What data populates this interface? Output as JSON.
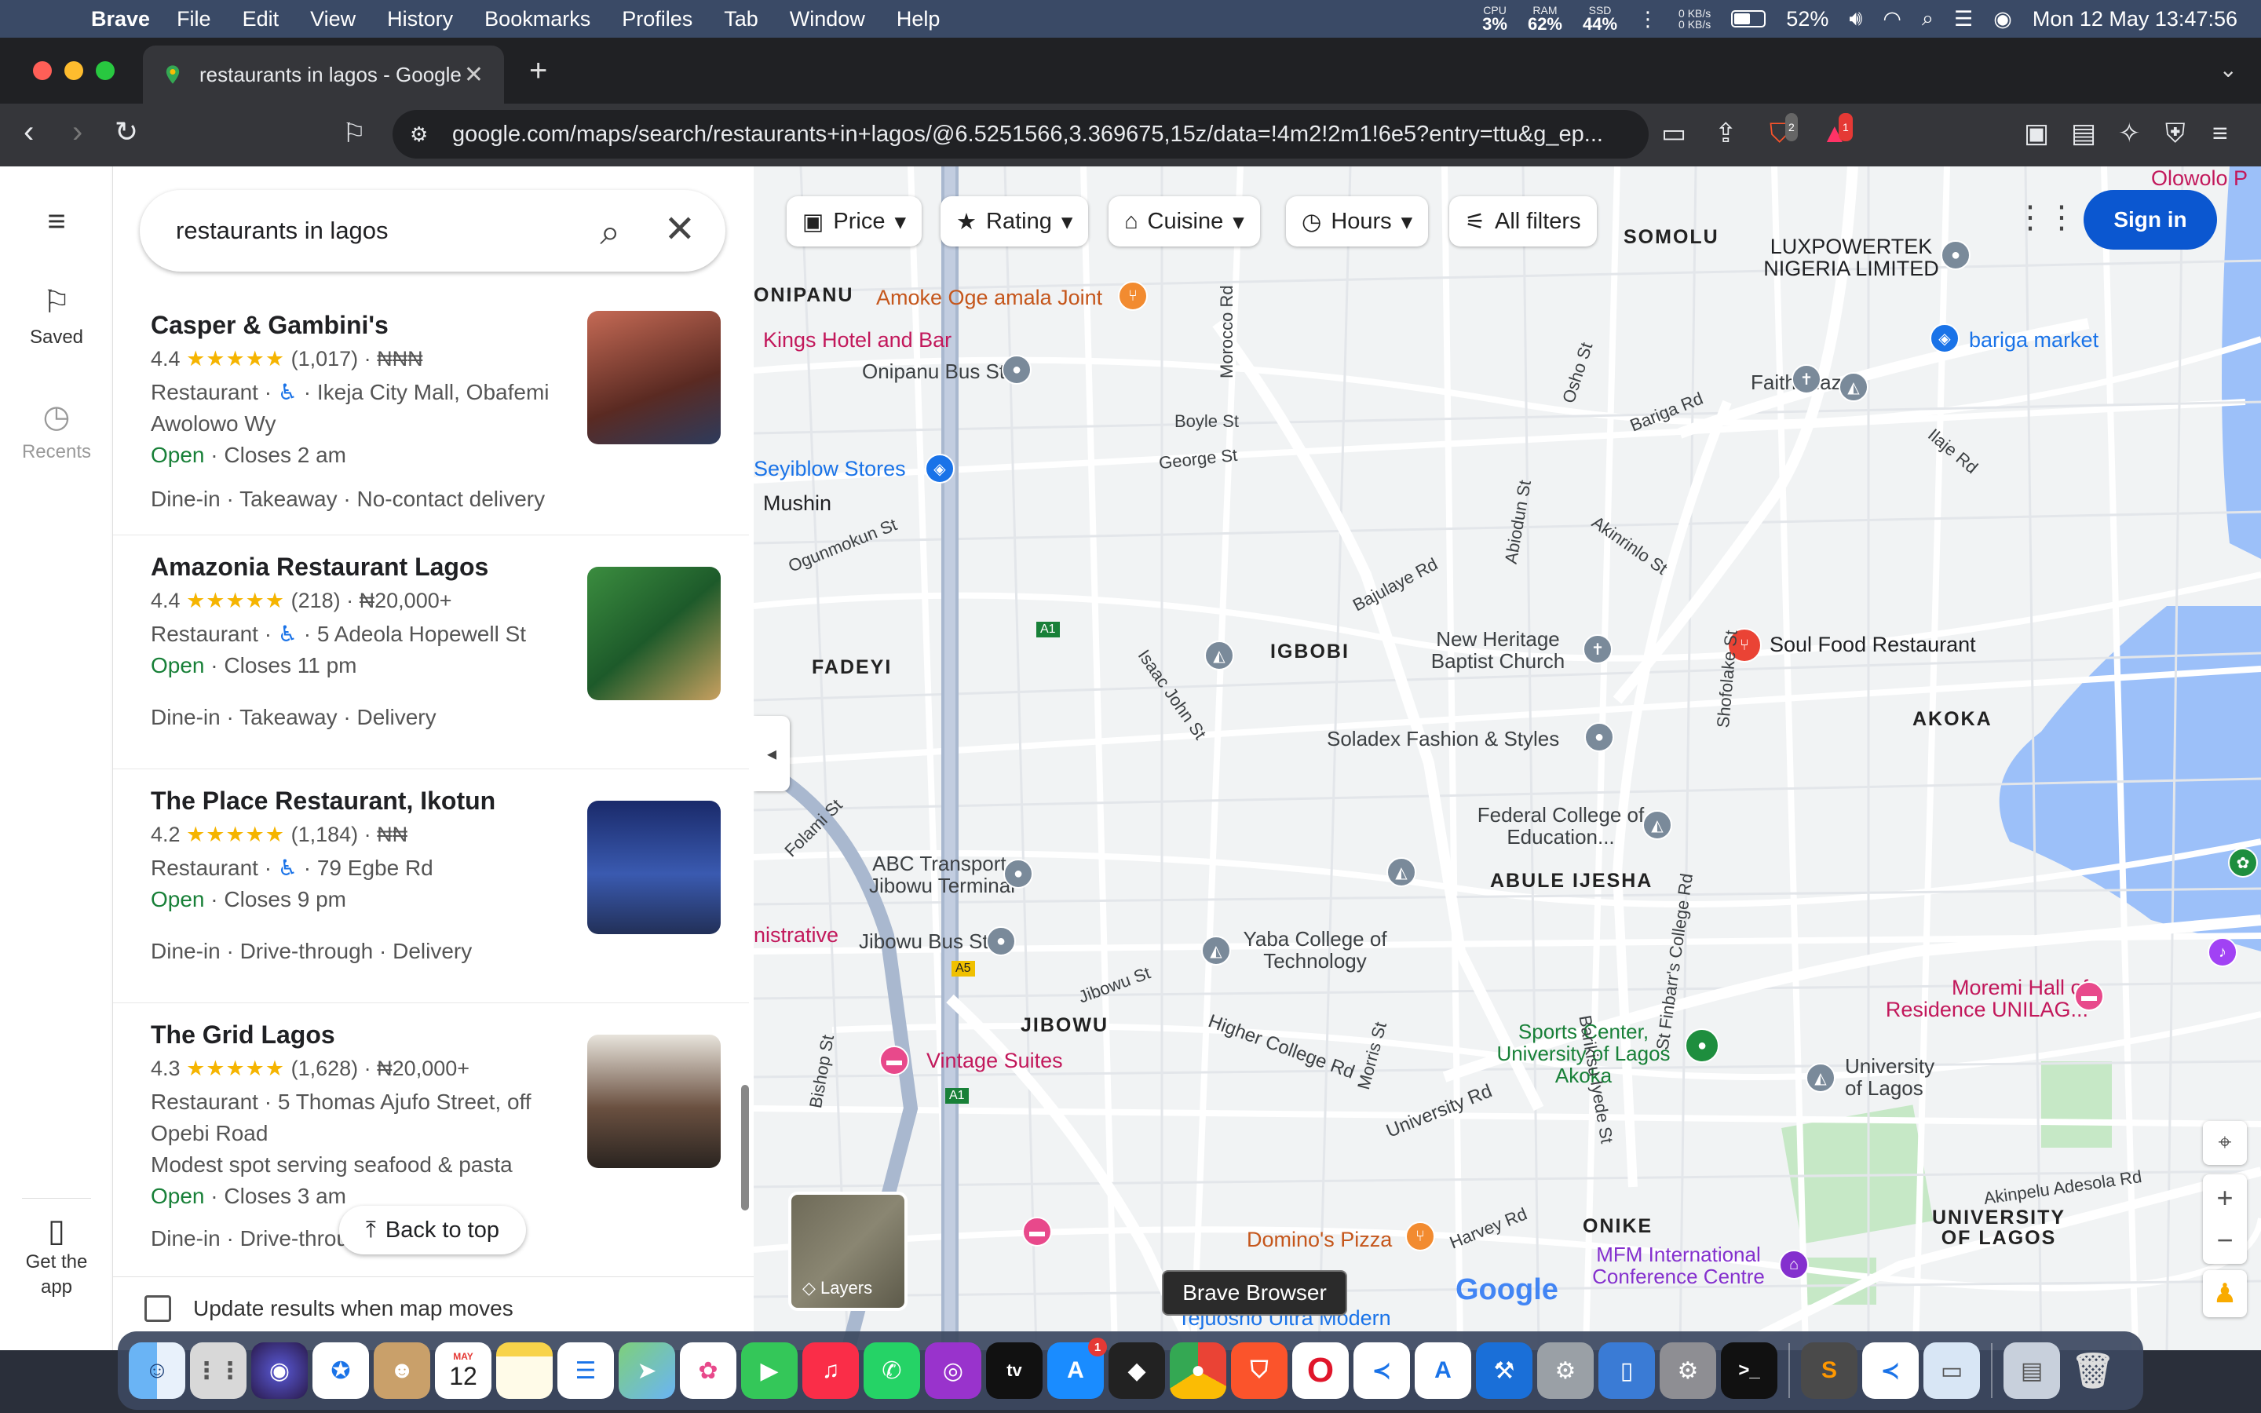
{
  "menubar": {
    "app_name": "Brave",
    "items": [
      "File",
      "Edit",
      "View",
      "History",
      "Bookmarks",
      "Profiles",
      "Tab",
      "Window",
      "Help"
    ],
    "cpu": {
      "label": "CPU",
      "value": "3%"
    },
    "ram": {
      "label": "RAM",
      "value": "62%"
    },
    "ssd": {
      "label": "SSD",
      "value": "44%"
    },
    "net_up": "0 KB/s",
    "net_down": "0 KB/s",
    "battery": "52%",
    "datetime": "Mon 12 May  13:47:56"
  },
  "browser": {
    "tab_title": "restaurants in lagos - Google",
    "url": "google.com/maps/search/restaurants+in+lagos/@6.5251566,3.369675,15z/data=!4m2!2m1!6e5?entry=ttu&g_ep...",
    "brave_shield_count": "2",
    "rewards_count": "1"
  },
  "rail": {
    "saved": "Saved",
    "recents": "Recents",
    "get_app": "Get the app"
  },
  "search": {
    "query": "restaurants in lagos"
  },
  "results": [
    {
      "name": "Casper & Gambini's",
      "rating": "4.4",
      "stars": "★★★★★",
      "reviews": "(1,017)",
      "price": "₦₦₦",
      "category": "Restaurant",
      "address": "Ikeja City Mall, Obafemi Awolowo Wy",
      "open": "Open",
      "hours": "Closes 2 am",
      "services": "Dine-in · Takeaway · No-contact delivery",
      "photo_color": "#a34a3a"
    },
    {
      "name": "Amazonia Restaurant Lagos",
      "rating": "4.4",
      "stars": "★★★★★",
      "reviews": "(218)",
      "price": "₦20,000+",
      "category": "Restaurant",
      "address": "5 Adeola Hopewell St",
      "open": "Open",
      "hours": "Closes 11 pm",
      "services": "Dine-in · Takeaway · Delivery",
      "photo_color": "#2f7a3c"
    },
    {
      "name": "The Place Restaurant, Ikotun",
      "rating": "4.2",
      "stars": "★★★★★",
      "reviews": "(1,184)",
      "price": "₦₦",
      "category": "Restaurant",
      "address": "79 Egbe Rd",
      "open": "Open",
      "hours": "Closes 9 pm",
      "services": "Dine-in · Drive-through · Delivery",
      "photo_color": "#1f3b7a"
    },
    {
      "name": "The Grid Lagos",
      "rating": "4.3",
      "stars": "★★★★★",
      "reviews": "(1,628)",
      "price": "₦20,000+",
      "category": "Restaurant",
      "address": "5 Thomas Ajufo Street, off Opebi Road",
      "description": "Modest spot serving seafood & pasta",
      "open": "Open",
      "hours": "Closes 3 am",
      "services": "Dine-in · Drive-throu",
      "photo_color": "#5a4a3c"
    }
  ],
  "panel": {
    "back_to_top": "Back to top",
    "update_results": "Update results when map moves"
  },
  "filters": [
    "Price",
    "Rating",
    "Cuisine",
    "Hours",
    "All filters"
  ],
  "map": {
    "sign_in": "Sign in",
    "layers": "Layers",
    "tooltip": "Brave Browser",
    "google": "Google",
    "areas": [
      "ONIPANU",
      "SOMOLU",
      "FADEYI",
      "IGBOBI",
      "AKOKA",
      "ABULE IJESHA",
      "JIBOWU",
      "ONIKE",
      "UNIVERSITY OF LAGOS"
    ],
    "places": {
      "amoke": "Amoke Oge amala Joint",
      "kings": "Kings Hotel and Bar",
      "onipanu_bus": "Onipanu Bus Stop",
      "seyiblow": "Seyiblow Stores",
      "mushin": "Mushin",
      "luxpowertek": "LUXPOWERTEK NIGERIA LIMITED",
      "bariga_market": "bariga market",
      "faith_plaza": "Faith Plaza",
      "new_heritage": "New Heritage Baptist Church",
      "soul_food": "Soul Food Restaurant",
      "soladex": "Soladex Fashion & Styles",
      "fed_college": "Federal College of Education...",
      "abc": "ABC Transport. Jibowu Terminal",
      "jibowu_bus": "Jibowu Bus Stop",
      "yaba_college": "Yaba College of Technology",
      "administrative": "nistrative",
      "vintage": "Vintage Suites",
      "sports_center": "Sports Center, University of Lagos Akoka",
      "moremi": "Moremi Hall of Residence UNILAG...",
      "unilag": "University of Lagos",
      "dominos": "Domino's Pizza",
      "mfm": "MFM International Conference Centre",
      "tejuosho": "Tejuosho Ultra Modern",
      "olowolo": "Olowolo P"
    },
    "streets": {
      "boyle": "Boyle St",
      "george": "George St",
      "morocco": "Morocco Rd",
      "ogunmokun": "Ogunmokun St",
      "bajulaye": "Bajulaye Rd",
      "abiodun": "Abiodun St",
      "akinrinlo": "Akinrinlo St",
      "bariga": "Bariga Rd",
      "osho": "Osho St",
      "ilaje": "Ilaje Rd",
      "isaac_john": "Isaac John St",
      "shofolake": "Shofolake St",
      "folami": "Folami St",
      "st_finbarrs": "St Finbarr's College Rd",
      "jibowu_st": "Jibowu St",
      "higher_college": "Higher College Rd",
      "morris": "Morris St",
      "university_rd": "University Rd",
      "barikisu": "Barikisu Iyede St",
      "bishop": "Bishop St",
      "harvey": "Harvey Rd",
      "akinpelu": "Akinpelu Adesola Rd"
    },
    "road_shields": [
      "A1",
      "A5"
    ]
  },
  "dock": {
    "calendar_month": "MAY",
    "calendar_day": "12",
    "appstore_badge": "1"
  }
}
